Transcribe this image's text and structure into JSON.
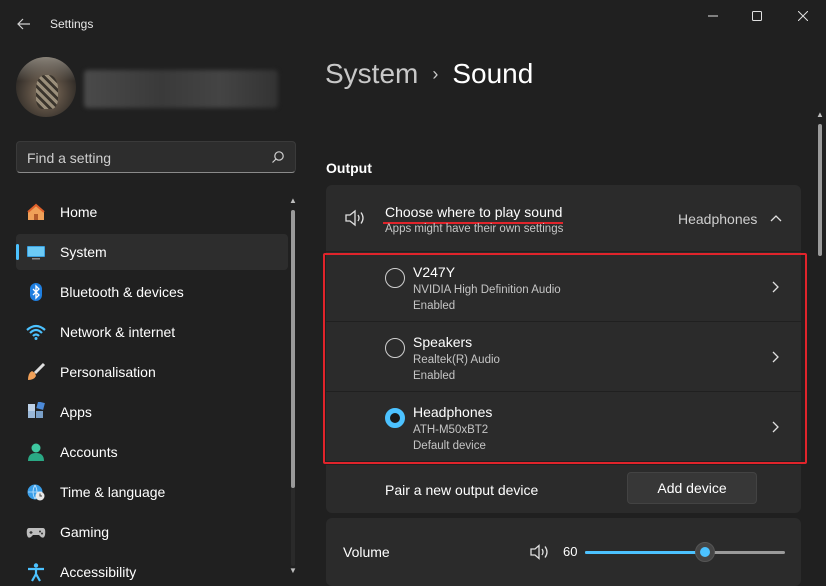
{
  "window": {
    "title": "Settings",
    "back_icon": "back-arrow-icon",
    "controls": {
      "minimize": "—",
      "maximize": "☐",
      "close": "✕"
    }
  },
  "sidebar": {
    "search_placeholder": "Find a setting",
    "items": [
      {
        "label": "Home",
        "icon": "home-icon",
        "active": false
      },
      {
        "label": "System",
        "icon": "system-icon",
        "active": true
      },
      {
        "label": "Bluetooth & devices",
        "icon": "bluetooth-icon",
        "active": false
      },
      {
        "label": "Network & internet",
        "icon": "wifi-icon",
        "active": false
      },
      {
        "label": "Personalisation",
        "icon": "brush-icon",
        "active": false
      },
      {
        "label": "Apps",
        "icon": "apps-icon",
        "active": false
      },
      {
        "label": "Accounts",
        "icon": "accounts-icon",
        "active": false
      },
      {
        "label": "Time & language",
        "icon": "globe-clock-icon",
        "active": false
      },
      {
        "label": "Gaming",
        "icon": "gamepad-icon",
        "active": false
      },
      {
        "label": "Accessibility",
        "icon": "accessibility-icon",
        "active": false
      }
    ]
  },
  "main": {
    "breadcrumb": {
      "parent": "System",
      "separator": "›",
      "current": "Sound"
    },
    "output_section": {
      "title": "Output",
      "choose": {
        "title": "Choose where to play sound",
        "subtitle": "Apps might have their own settings",
        "current_value": "Headphones"
      },
      "devices": [
        {
          "name": "V247Y",
          "driver": "NVIDIA High Definition Audio",
          "status": "Enabled",
          "selected": false
        },
        {
          "name": "Speakers",
          "driver": "Realtek(R) Audio",
          "status": "Enabled",
          "selected": false
        },
        {
          "name": "Headphones",
          "driver": "ATH-M50xBT2",
          "status": "Default device",
          "selected": true
        }
      ],
      "pair": {
        "label": "Pair a new output device",
        "button": "Add device"
      },
      "volume": {
        "label": "Volume",
        "value": "60",
        "level": 0.6
      }
    }
  },
  "colors": {
    "accent": "#4cc2ff",
    "highlight": "#e0242b",
    "background": "#202020",
    "card": "#2b2b2b"
  }
}
